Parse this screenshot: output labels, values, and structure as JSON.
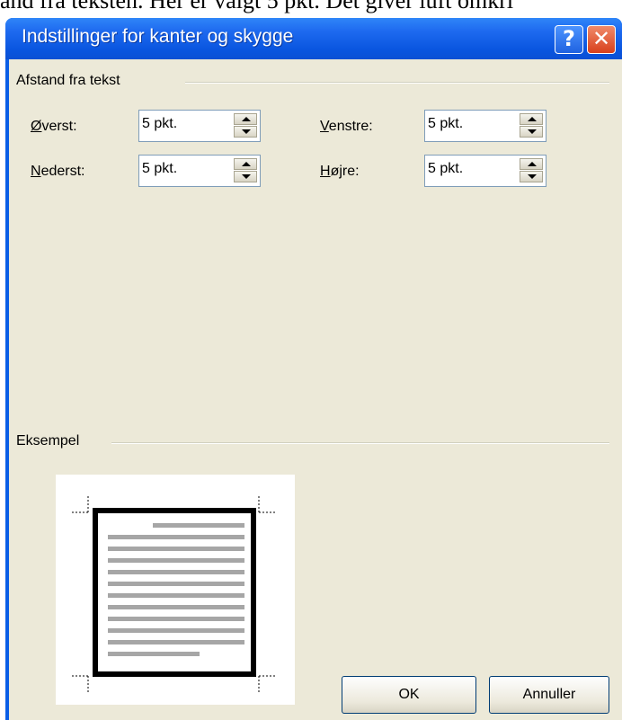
{
  "background_text": "and fra teksten. Her er valgt 5 pkt. Det giver luft omkri",
  "dialog": {
    "title": "Indstillinger for kanter og skygge",
    "help_glyph": "?",
    "close_glyph": "✕"
  },
  "distance_group": {
    "label": "Afstand fra tekst",
    "fields": {
      "top": {
        "mnemonic": "Ø",
        "rest": "verst:",
        "value": "5 pkt."
      },
      "bottom": {
        "mnemonic": "N",
        "rest": "ederst:",
        "value": "5 pkt."
      },
      "left": {
        "mnemonic": "V",
        "rest": "enstre:",
        "value": "5 pkt."
      },
      "right": {
        "mnemonic": "H",
        "rest": "øjre:",
        "value": "5 pkt."
      }
    }
  },
  "example_group": {
    "label": "Eksempel"
  },
  "buttons": {
    "ok": "OK",
    "cancel": "Annuller"
  },
  "colors": {
    "title_bar": "#0a56e0",
    "dialog_face": "#ece9d8",
    "close_button": "#d8401c"
  }
}
